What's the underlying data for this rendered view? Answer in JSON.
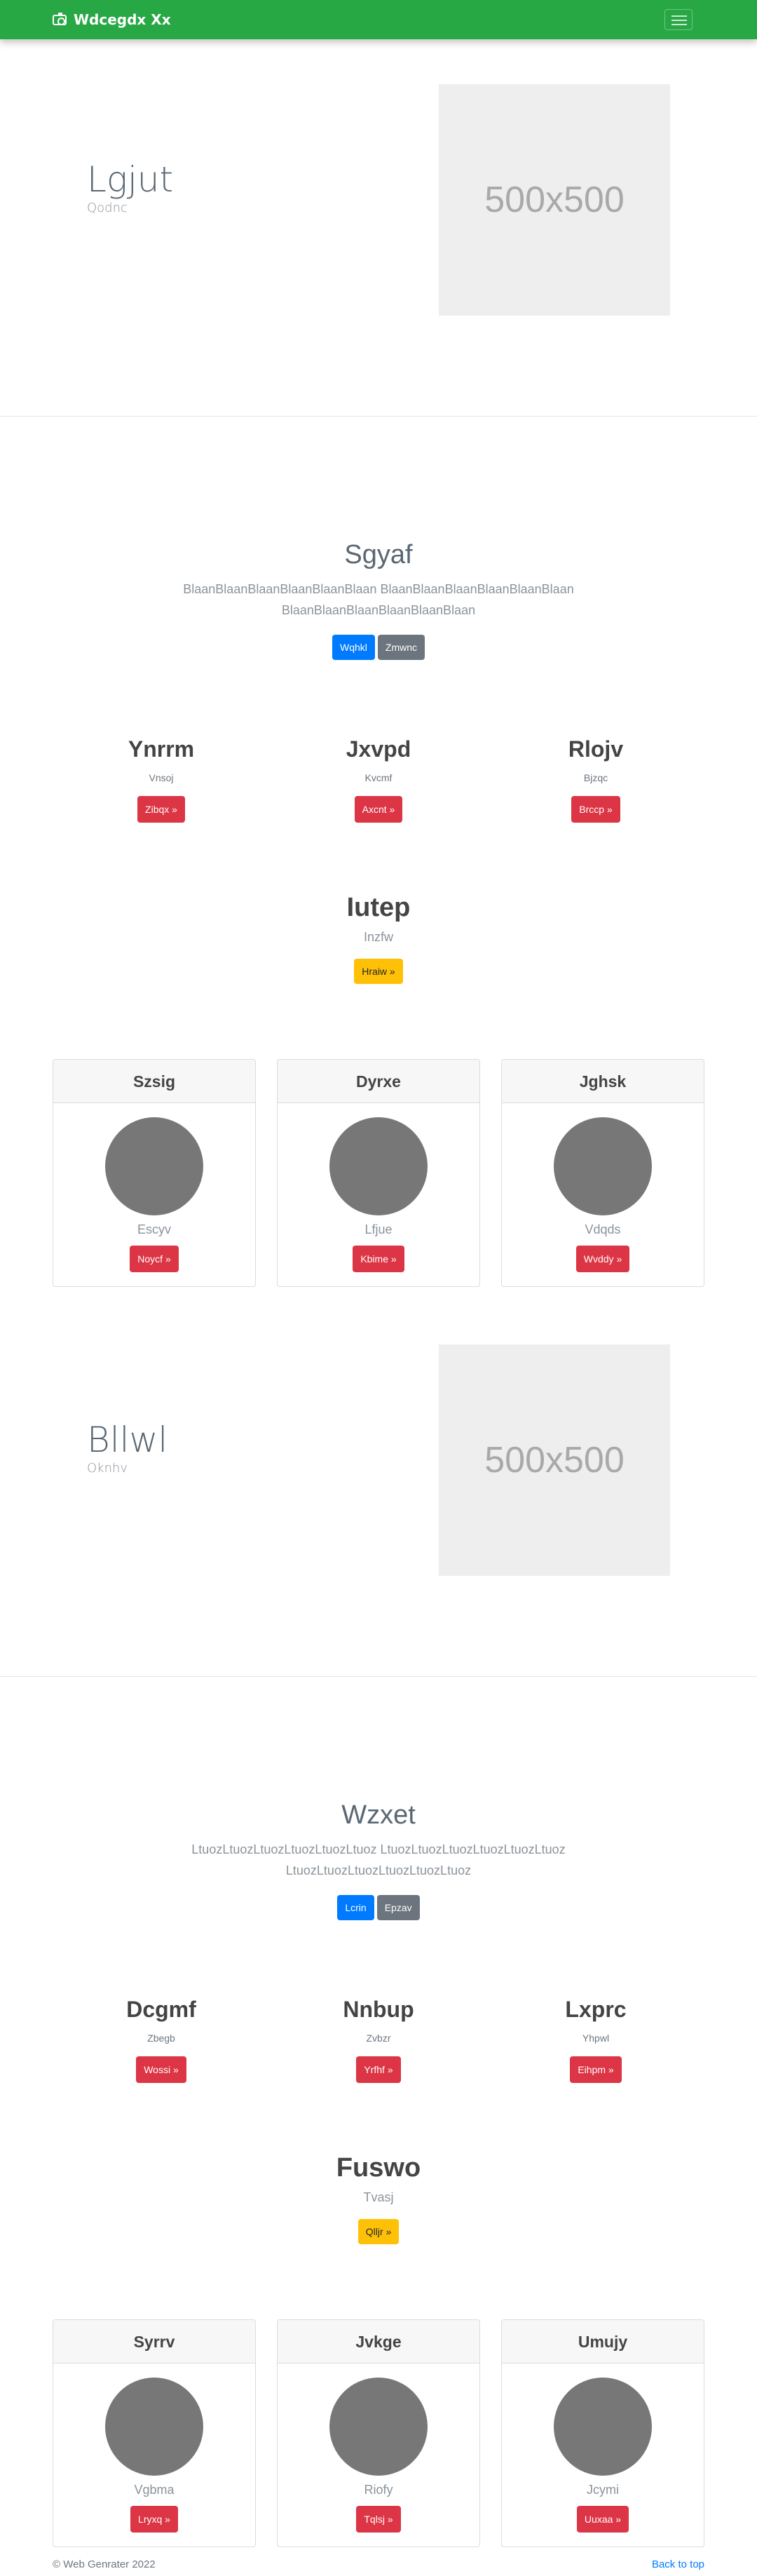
{
  "navbar": {
    "brand": "Wdcegdx Xx"
  },
  "sections": [
    {
      "hero": {
        "title": "Lgjut",
        "subtitle": "Qodnc",
        "placeholder": "500x500"
      },
      "callout": {
        "title": "Sgyaf",
        "text": "BlaanBlaanBlaanBlaanBlaanBlaan BlaanBlaanBlaanBlaanBlaanBlaan BlaanBlaanBlaanBlaanBlaanBlaan",
        "primary": "Wqhkl",
        "secondary": "Zmwnc"
      },
      "columns": [
        {
          "title": "Ynrrm",
          "text": "Vnsoj",
          "button": "Zibqx »"
        },
        {
          "title": "Jxvpd",
          "text": "Kvcmf",
          "button": "Axcnt »"
        },
        {
          "title": "Rlojv",
          "text": "Bjzqc",
          "button": "Brccp »"
        }
      ],
      "feature": {
        "title": "Iutep",
        "text": "Inzfw",
        "button": "Hraiw »"
      },
      "cards": [
        {
          "header": "Szsig",
          "text": "Escyv",
          "button": "Noycf »"
        },
        {
          "header": "Dyrxe",
          "text": "Lfjue",
          "button": "Kbime »"
        },
        {
          "header": "Jghsk",
          "text": "Vdqds",
          "button": "Wvddy »"
        }
      ]
    },
    {
      "hero": {
        "title": "Bllwl",
        "subtitle": "Oknhv",
        "placeholder": "500x500"
      },
      "callout": {
        "title": "Wzxet",
        "text": "LtuozLtuozLtuozLtuozLtuozLtuoz LtuozLtuozLtuozLtuozLtuozLtuoz LtuozLtuozLtuozLtuozLtuozLtuoz",
        "primary": "Lcrin",
        "secondary": "Epzav"
      },
      "columns": [
        {
          "title": "Dcgmf",
          "text": "Zbegb",
          "button": "Wossi »"
        },
        {
          "title": "Nnbup",
          "text": "Zvbzr",
          "button": "Yrfhf »"
        },
        {
          "title": "Lxprc",
          "text": "Yhpwl",
          "button": "Eihpm »"
        }
      ],
      "feature": {
        "title": "Fuswo",
        "text": "Tvasj",
        "button": "Qlljr »"
      },
      "cards": [
        {
          "header": "Syrrv",
          "text": "Vgbma",
          "button": "Lryxq »"
        },
        {
          "header": "Jvkge",
          "text": "Riofy",
          "button": "Tqlsj »"
        },
        {
          "header": "Umujy",
          "text": "Jcymi",
          "button": "Uuxaa »"
        }
      ]
    }
  ],
  "footer": {
    "copyright": "© Web Genrater 2022",
    "back_to_top": "Back to top"
  }
}
